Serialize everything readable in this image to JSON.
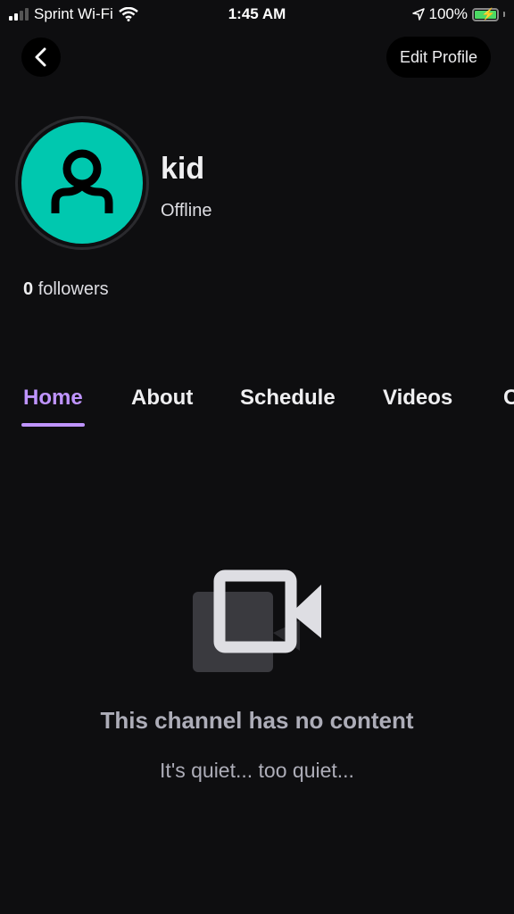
{
  "status_bar": {
    "carrier": "Sprint Wi-Fi",
    "time": "1:45 AM",
    "battery_percent": "100%",
    "signal_bars_active": 2,
    "signal_bars_total": 4,
    "charging": true
  },
  "header": {
    "back_icon": "chevron-left-icon",
    "edit_profile_label": "Edit Profile"
  },
  "profile": {
    "avatar_color": "#00c8af",
    "avatar_icon": "user-silhouette-icon",
    "username": "kid",
    "status": "Offline",
    "followers_count": "0",
    "followers_label": "followers"
  },
  "tabs": {
    "active_color": "#bf94ff",
    "items": [
      {
        "label": "Home",
        "active": true
      },
      {
        "label": "About",
        "active": false
      },
      {
        "label": "Schedule",
        "active": false
      },
      {
        "label": "Videos",
        "active": false
      },
      {
        "label": "Clips",
        "active": false
      }
    ]
  },
  "empty_state": {
    "icon": "video-camera-icon",
    "title": "This channel has no content",
    "subtitle": "It's quiet... too quiet..."
  }
}
